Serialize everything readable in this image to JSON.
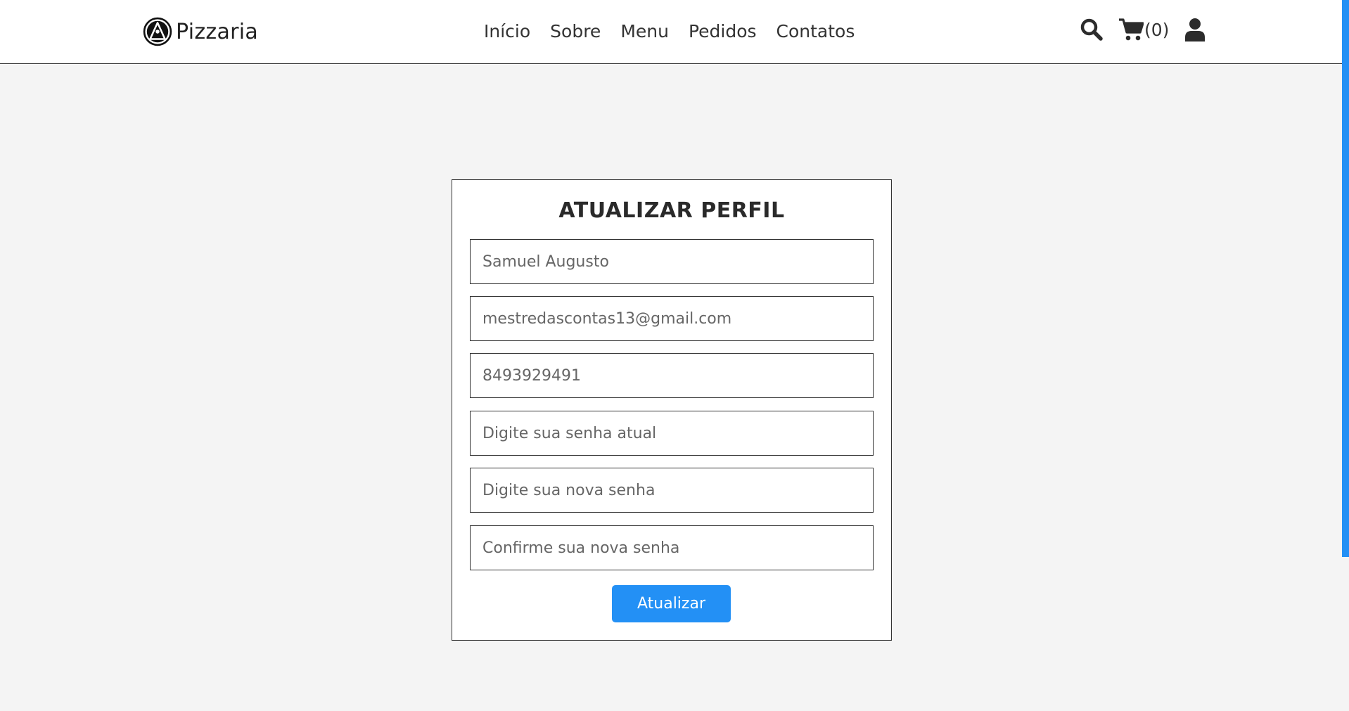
{
  "header": {
    "brand": "Pizzaria",
    "nav": [
      "Início",
      "Sobre",
      "Menu",
      "Pedidos",
      "Contatos"
    ],
    "cart_count": "(0)",
    "icons": {
      "logo": "pizza-logo-icon",
      "search": "search-icon",
      "cart": "cart-icon",
      "user": "user-icon"
    }
  },
  "form": {
    "title": "ATUALIZAR PERFIL",
    "name_placeholder": "Samuel Augusto",
    "email_placeholder": "mestredascontas13@gmail.com",
    "phone_placeholder": "8493929491",
    "current_password_placeholder": "Digite sua senha atual",
    "new_password_placeholder": "Digite sua nova senha",
    "confirm_password_placeholder": "Confirme sua nova senha",
    "submit_label": "Atualizar"
  },
  "colors": {
    "accent": "#2390f5",
    "background": "#f4f4f4",
    "text": "#333333"
  }
}
